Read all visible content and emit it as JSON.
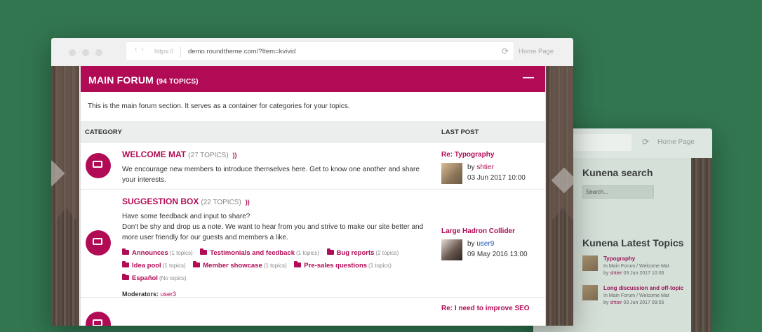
{
  "browser": {
    "protocol": "https://",
    "url": "demo.roundtheme.com/?Item=kvivid",
    "home_label": "Home Page"
  },
  "forum": {
    "title": "MAIN FORUM",
    "count": "(94 TOPICS)",
    "collapse_icon": "minus-icon",
    "description": "This is the main forum section. It serves as a container for categories for your topics.",
    "columns": {
      "category": "CATEGORY",
      "last_post": "LAST POST"
    },
    "categories": [
      {
        "name": "WELCOME MAT",
        "count": "(27 TOPICS)",
        "description": "We encourage new members to introduce themselves here. Get to know one another and share your interests.",
        "last_post": {
          "title": "Re: Typography",
          "by_prefix": "by",
          "user": "shtier",
          "date": "03 Jun 2017 10:00"
        }
      },
      {
        "name": "SUGGESTION BOX",
        "count": "(22 TOPICS)",
        "description_1": "Have some feedback and input to share?",
        "description_2": "Don't be shy and drop us a note. We want to hear from you and strive to make our site better and more user friendly for our guests and members a like.",
        "subcategories": [
          {
            "label": "Announces",
            "count": "(1 topics)"
          },
          {
            "label": "Testimonials and feedback",
            "count": "(1 topics)"
          },
          {
            "label": "Bug reports",
            "count": "(2 topics)"
          },
          {
            "label": "Idea pool",
            "count": "(1 topics)"
          },
          {
            "label": "Member showcase",
            "count": "(1 topics)"
          },
          {
            "label": "Pre-sales questions",
            "count": "(1 topics)"
          },
          {
            "label": "Español",
            "count": "(No topics)"
          }
        ],
        "moderators_label": "Moderators:",
        "moderator": "user3",
        "last_post": {
          "title": "Large Hadron Collider",
          "by_prefix": "by",
          "user": "user9",
          "date": "09 May 2016 13:00"
        }
      },
      {
        "last_post": {
          "title": "Re: I need to improve SEO"
        }
      }
    ]
  },
  "side_window": {
    "home_label": "Home Page",
    "search_title": "Kunena search",
    "search_placeholder": "Search...",
    "latest_title": "Kunena Latest Topics",
    "topics": [
      {
        "title": "Typography",
        "path": "In Main Forum / Welcome Mat",
        "by_prefix": "by",
        "user": "shtier",
        "date": "03 Jun 2017 10:00"
      },
      {
        "title": "Long discussion and off-topic",
        "path": "In Main Forum / Welcome Mat",
        "by_prefix": "by",
        "user": "shtier",
        "date": "03 Jun 2017 09:55"
      }
    ]
  },
  "colors": {
    "accent": "#b10b56",
    "background": "#327650"
  }
}
